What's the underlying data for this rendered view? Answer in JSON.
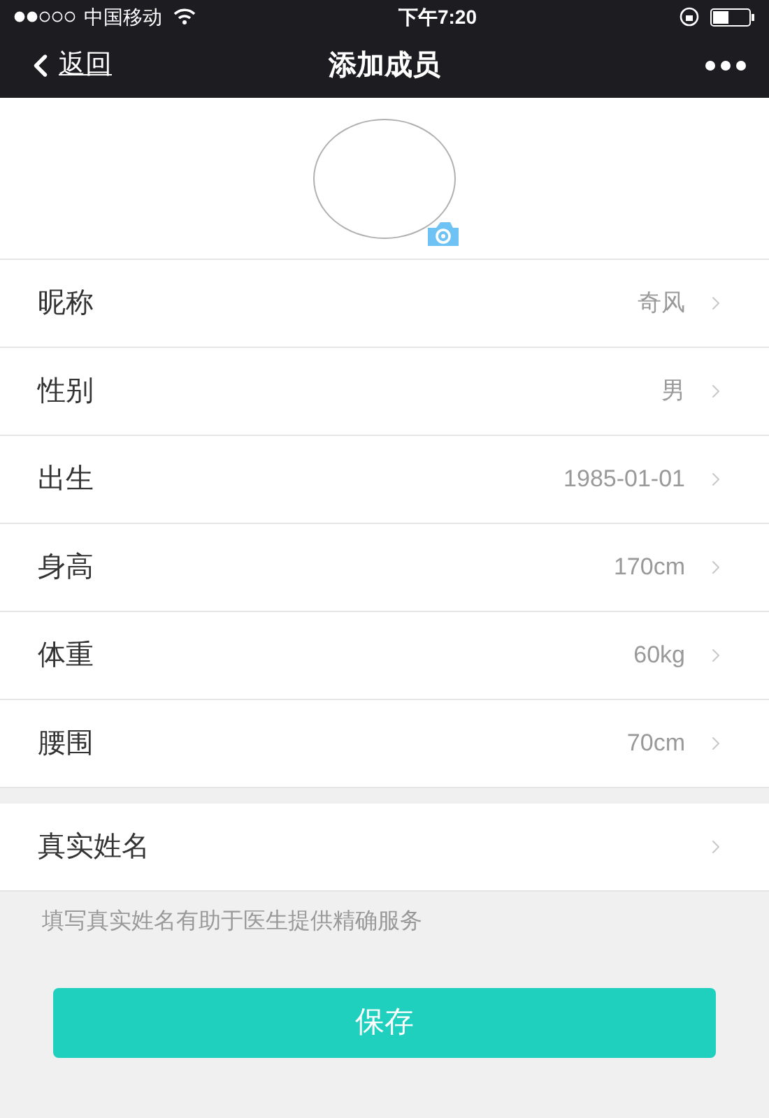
{
  "status_bar": {
    "carrier": "中国移动",
    "time": "下午7:20"
  },
  "nav": {
    "back": "返回",
    "title": "添加成员"
  },
  "fields": [
    {
      "label": "昵称",
      "value": "奇风"
    },
    {
      "label": "性别",
      "value": "男"
    },
    {
      "label": "出生",
      "value": "1985-01-01"
    },
    {
      "label": "身高",
      "value": "170cm"
    },
    {
      "label": "体重",
      "value": "60kg"
    },
    {
      "label": "腰围",
      "value": "70cm"
    }
  ],
  "real_name": {
    "label": "真实姓名",
    "hint": "填写真实姓名有助于医生提供精确服务"
  },
  "save_button": "保存"
}
